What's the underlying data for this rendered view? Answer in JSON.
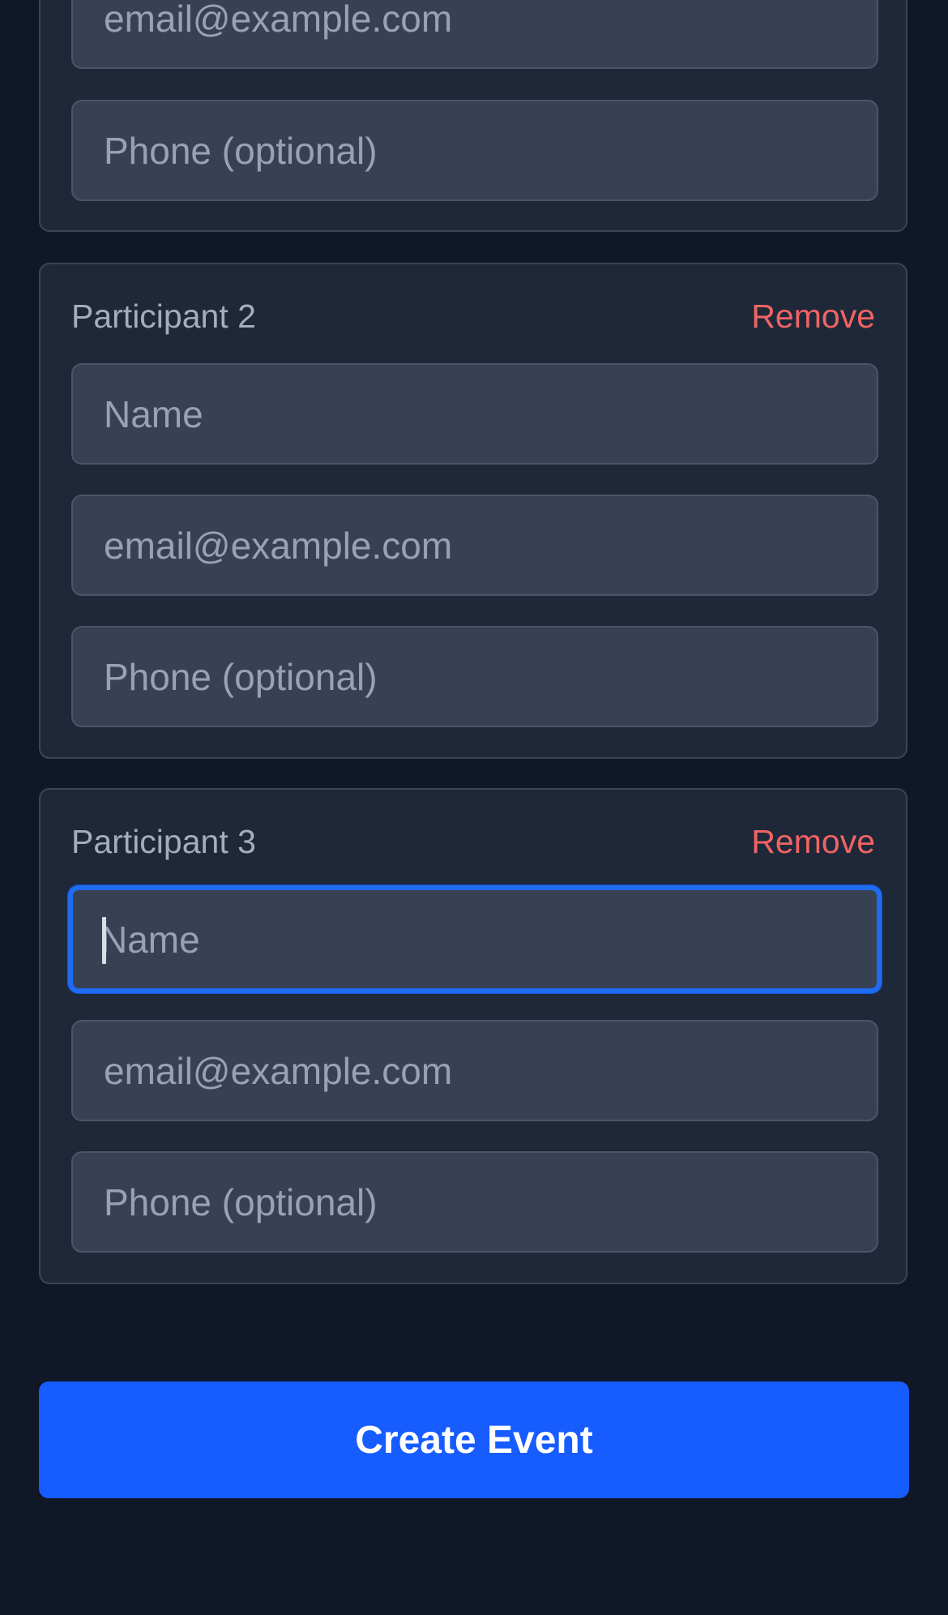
{
  "participant_1": {
    "email_placeholder": "email@example.com",
    "phone_placeholder": "Phone (optional)"
  },
  "participant_2": {
    "label": "Participant 2",
    "remove_label": "Remove",
    "name_placeholder": "Name",
    "email_placeholder": "email@example.com",
    "phone_placeholder": "Phone (optional)"
  },
  "participant_3": {
    "label": "Participant 3",
    "remove_label": "Remove",
    "name_placeholder": "Name",
    "email_placeholder": "email@example.com",
    "phone_placeholder": "Phone (optional)",
    "focused_field": "name"
  },
  "actions": {
    "create_label": "Create Event"
  },
  "colors": {
    "page_background": "#101726",
    "card_background": "#1f2839",
    "input_background": "#374153",
    "remove_accent": "#f06464",
    "focus_ring": "#1f6bf1",
    "primary_button": "#175cff"
  }
}
